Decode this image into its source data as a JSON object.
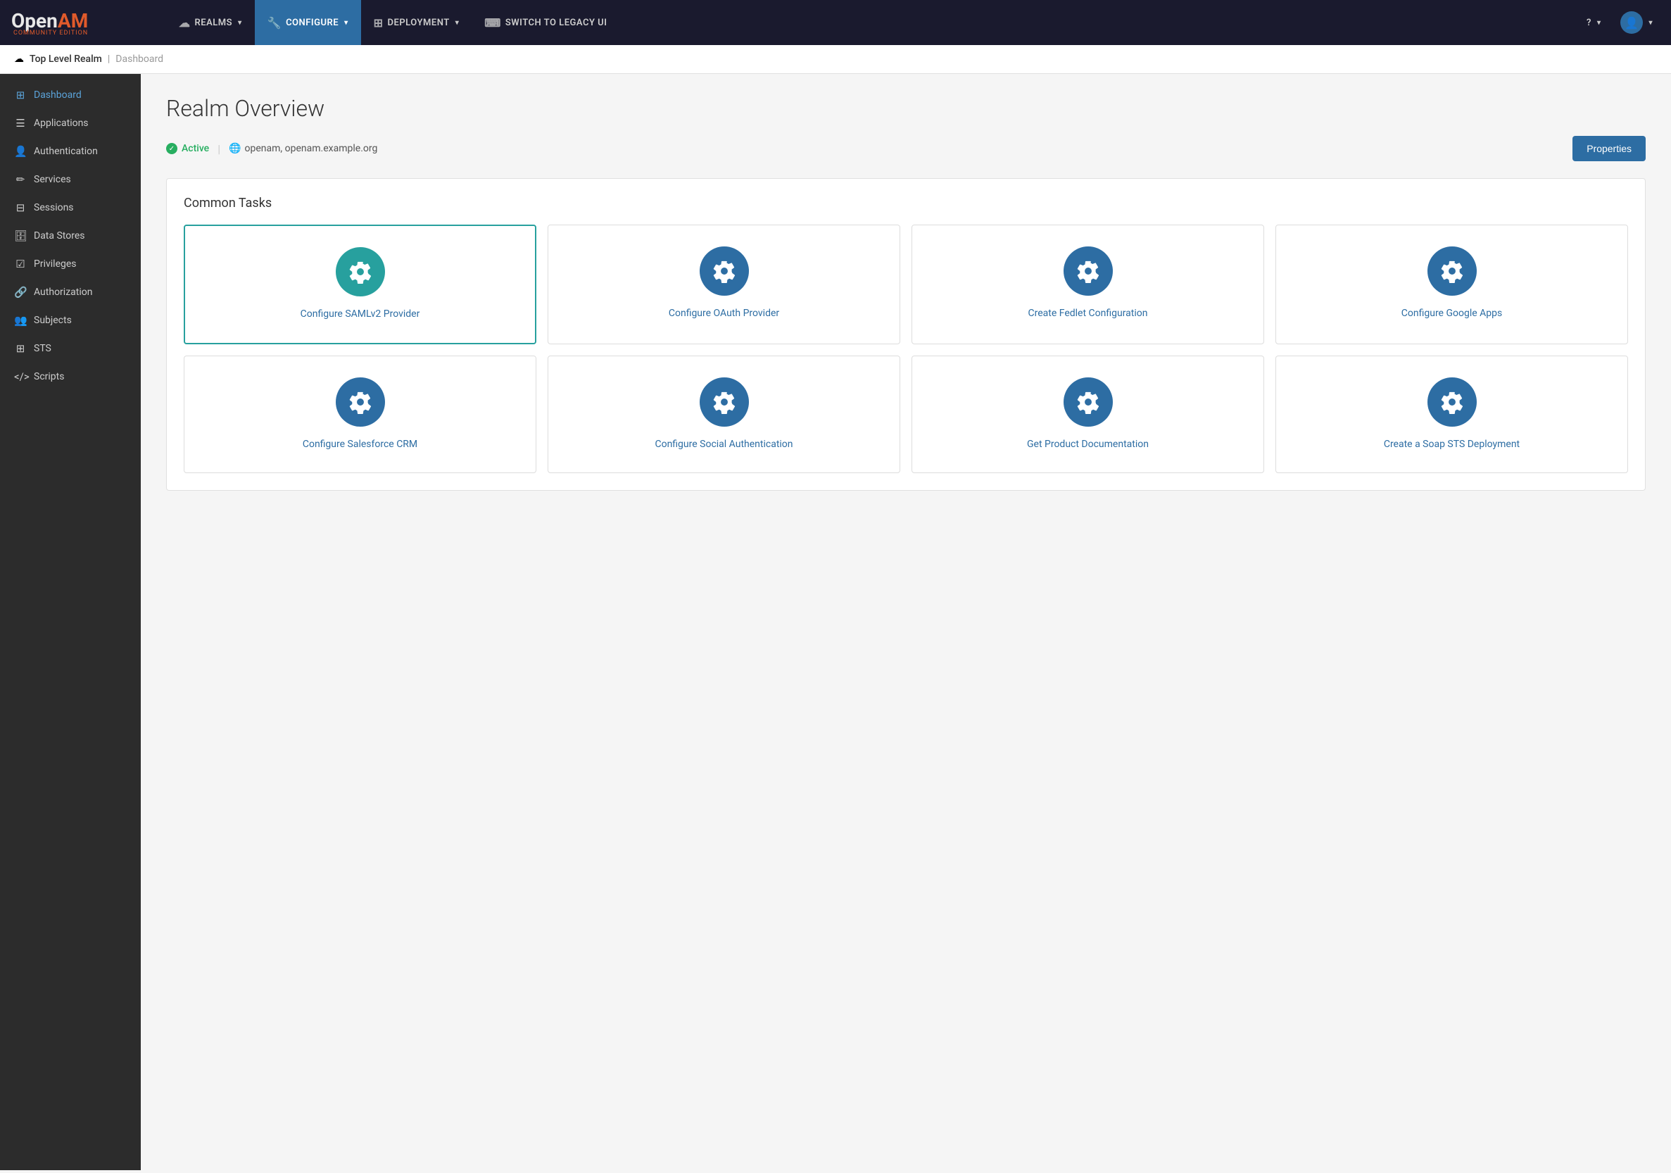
{
  "logo": {
    "open": "Open",
    "am": "AM",
    "sub": "COMMUNITY EDITION"
  },
  "nav": {
    "items": [
      {
        "id": "realms",
        "label": "REALMS",
        "icon": "☁",
        "active": false,
        "hasChevron": true
      },
      {
        "id": "configure",
        "label": "CONFIGURE",
        "icon": "🔧",
        "active": true,
        "hasChevron": true
      },
      {
        "id": "deployment",
        "label": "DEPLOYMENT",
        "icon": "⊞",
        "active": false,
        "hasChevron": true
      },
      {
        "id": "legacy",
        "label": "SWITCH TO LEGACY UI",
        "icon": ">_",
        "active": false,
        "hasChevron": false
      }
    ],
    "help_label": "?",
    "user_icon": "👤"
  },
  "breadcrumb": {
    "realm_icon": "☁",
    "realm_label": "Top Level Realm",
    "separator": "|",
    "current": "Dashboard"
  },
  "sidebar": {
    "items": [
      {
        "id": "dashboard",
        "icon": "⊞",
        "label": "Dashboard",
        "active": true
      },
      {
        "id": "applications",
        "icon": "☰",
        "label": "Applications",
        "active": false
      },
      {
        "id": "authentication",
        "icon": "👤",
        "label": "Authentication",
        "active": false
      },
      {
        "id": "services",
        "icon": "✏",
        "label": "Services",
        "active": false
      },
      {
        "id": "sessions",
        "icon": "⊟",
        "label": "Sessions",
        "active": false
      },
      {
        "id": "data-stores",
        "icon": "🗄",
        "label": "Data Stores",
        "active": false
      },
      {
        "id": "privileges",
        "icon": "☑",
        "label": "Privileges",
        "active": false
      },
      {
        "id": "authorization",
        "icon": "🔗",
        "label": "Authorization",
        "active": false
      },
      {
        "id": "subjects",
        "icon": "👥",
        "label": "Subjects",
        "active": false
      },
      {
        "id": "sts",
        "icon": "⊞",
        "label": "STS",
        "active": false
      },
      {
        "id": "scripts",
        "icon": "</>",
        "label": "Scripts",
        "active": false
      }
    ]
  },
  "main": {
    "page_title": "Realm Overview",
    "status": {
      "active_label": "Active",
      "url_label": "openam, openam.example.org"
    },
    "properties_btn": "Properties",
    "common_tasks_title": "Common Tasks",
    "tasks": [
      {
        "id": "samlv2",
        "label": "Configure SAMLv2 Provider",
        "icon_style": "teal",
        "selected": true
      },
      {
        "id": "oauth",
        "label": "Configure OAuth Provider",
        "icon_style": "blue",
        "selected": false
      },
      {
        "id": "fedlet",
        "label": "Create Fedlet Configuration",
        "icon_style": "blue",
        "selected": false
      },
      {
        "id": "google",
        "label": "Configure Google Apps",
        "icon_style": "blue",
        "selected": false
      },
      {
        "id": "salesforce",
        "label": "Configure Salesforce CRM",
        "icon_style": "blue",
        "selected": false
      },
      {
        "id": "social",
        "label": "Configure Social Authentication",
        "icon_style": "blue",
        "selected": false
      },
      {
        "id": "docs",
        "label": "Get Product Documentation",
        "icon_style": "blue",
        "selected": false
      },
      {
        "id": "soap",
        "label": "Create a Soap STS Deployment",
        "icon_style": "blue",
        "selected": false
      }
    ]
  }
}
